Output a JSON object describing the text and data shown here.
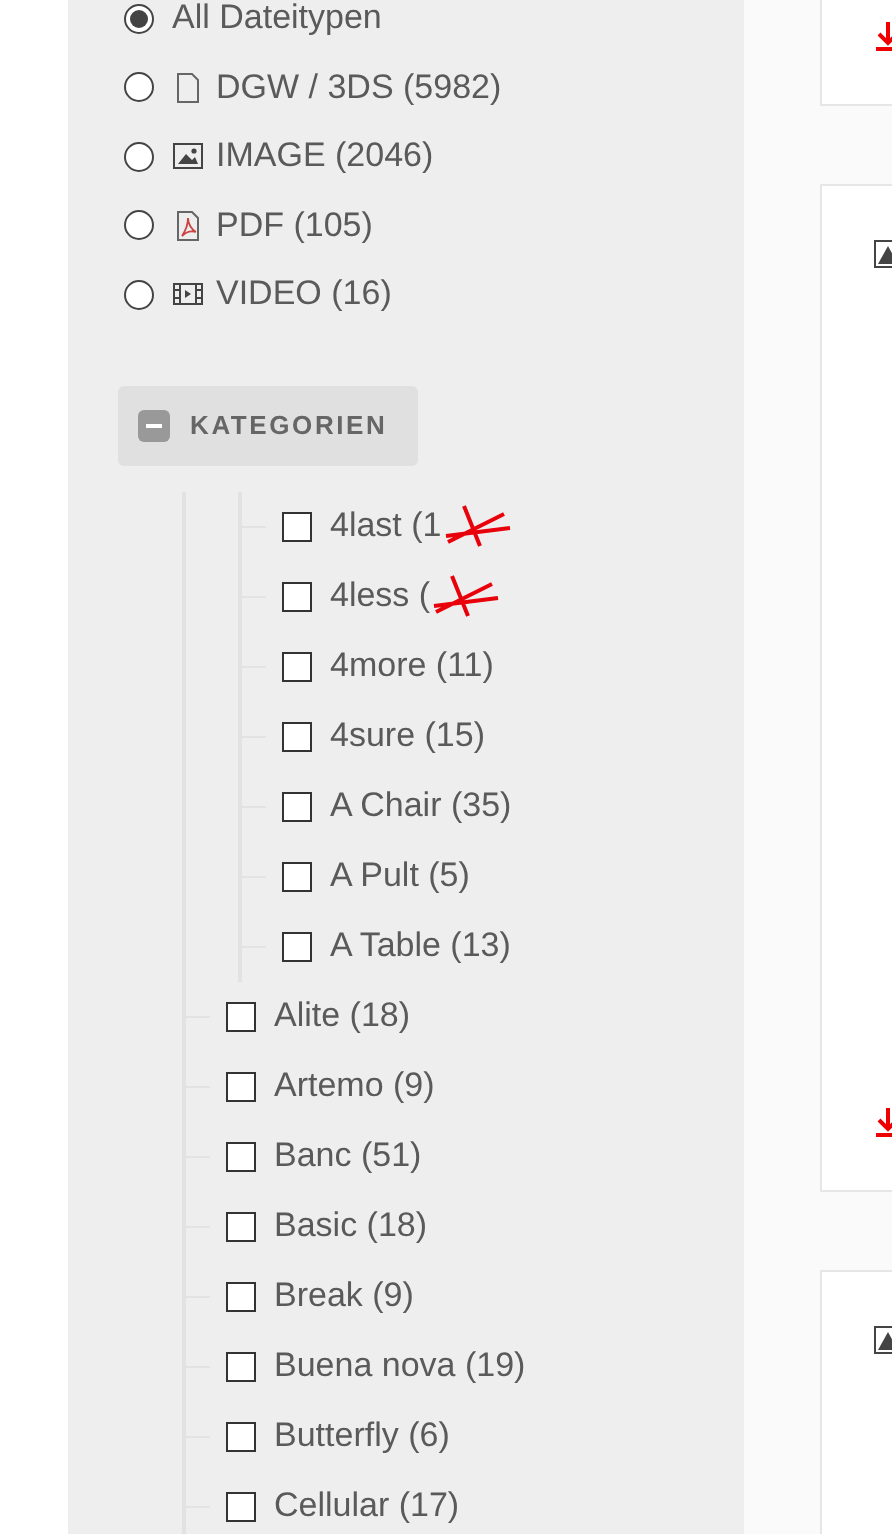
{
  "file_types": [
    {
      "label": "All Dateitypen",
      "kind": "all",
      "selected": true
    },
    {
      "label": "DGW / 3DS (5982)",
      "kind": "file",
      "selected": false
    },
    {
      "label": "IMAGE (2046)",
      "kind": "image",
      "selected": false
    },
    {
      "label": "PDF (105)",
      "kind": "pdf",
      "selected": false
    },
    {
      "label": "VIDEO (16)",
      "kind": "video",
      "selected": false
    }
  ],
  "category_toggle": {
    "label": "KATEGORIEN",
    "expanded": true
  },
  "categories": [
    {
      "children": [
        {
          "label": "4last (1",
          "checked": false,
          "scribbled": true
        },
        {
          "label": "4less (",
          "checked": false,
          "scribbled": true
        },
        {
          "label": "4more (11)",
          "checked": false,
          "scribbled": false
        },
        {
          "label": "4sure (15)",
          "checked": false,
          "scribbled": false
        },
        {
          "label": "A Chair (35)",
          "checked": false,
          "scribbled": false
        },
        {
          "label": "A Pult (5)",
          "checked": false,
          "scribbled": false
        },
        {
          "label": "A Table (13)",
          "checked": false,
          "scribbled": false
        }
      ]
    },
    {
      "label": "Alite (18)",
      "checked": false,
      "scribbled": false
    },
    {
      "label": "Artemo (9)",
      "checked": false,
      "scribbled": false
    },
    {
      "label": "Banc (51)",
      "checked": false,
      "scribbled": false
    },
    {
      "label": "Basic (18)",
      "checked": false,
      "scribbled": false
    },
    {
      "label": "Break (9)",
      "checked": false,
      "scribbled": false
    },
    {
      "label": "Buena nova (19)",
      "checked": false,
      "scribbled": false
    },
    {
      "label": "Butterfly (6)",
      "checked": false,
      "scribbled": false
    },
    {
      "label": "Cellular (17)",
      "checked": false,
      "scribbled": false
    }
  ],
  "result_cards": [
    {
      "image_icon": false,
      "download": true
    },
    {
      "image_icon": true,
      "download": true
    },
    {
      "image_icon": true,
      "download": false
    }
  ]
}
